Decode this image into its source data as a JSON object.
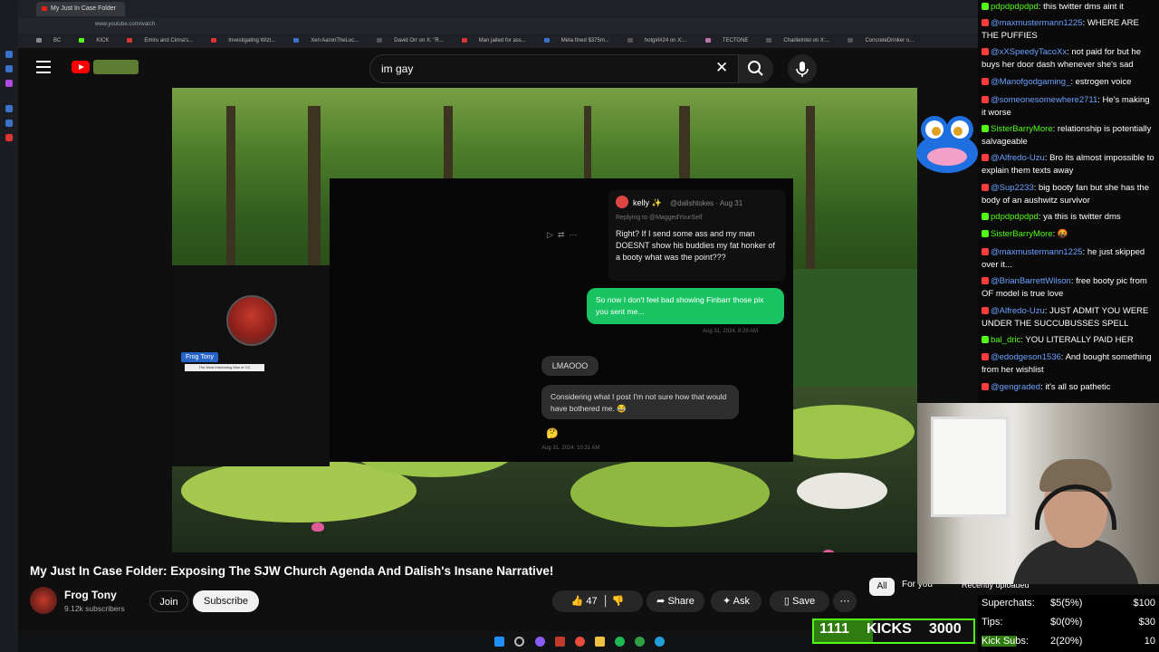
{
  "browser": {
    "active_tab": "My Just In Case Folder",
    "url": "www.youtube.com/watch",
    "bookmarks": [
      "BC",
      "KICK",
      "Emiru and Cinna's...",
      "Investigating Wizt...",
      "Xen AaronTheLoc...",
      "David Orr on X: \"R...",
      "Man jailed for ass...",
      "Meta fined $375m...",
      "hotgirl#24 on X:...",
      "TECTONE",
      "CharlieIntel on X:...",
      "ConcreteDrinker o..."
    ]
  },
  "search": {
    "query": "im gay"
  },
  "video": {
    "stream_name_tag": "Frog Tony",
    "stream_subtag": "The Most Interesting Man in CG",
    "tweet": {
      "author": "kelly ✨",
      "handle": "@dalishtokes · Aug 31",
      "replying": "Replying to @MaggedYourSelf",
      "body": "Right? If I send some ass and my man DOESNT show his buddies my fat honker of a booty what was the point???"
    },
    "dm_green": "So now I don't feel bad showing Finbarr those pix you sent me...",
    "dm_green_time": "Aug 31, 2024, 8:29 AM",
    "dm_lmao": "LMAOOO",
    "dm_consider": "Considering what I post I'm not sure how that would have bothered me. 😂",
    "dm_emoji": "🤔",
    "dm_time2": "Aug 31, 2024, 10:31 AM"
  },
  "meta": {
    "title": "My Just In Case Folder: Exposing The SJW Church Agenda And Dalish's Insane Narrative!",
    "channel": "Frog Tony",
    "subscribers": "9.12k subscribers",
    "join": "Join",
    "subscribe": "Subscribe",
    "likes": "47",
    "share": "Share",
    "ask": "Ask",
    "save": "Save",
    "filters": [
      "All",
      "For you",
      "Recently uploaded"
    ]
  },
  "chat": [
    {
      "platform": "kick",
      "user": "pdpdpdpdpd",
      "msg": "this twitter dms aint it"
    },
    {
      "platform": "youtube",
      "user": "@maxmustermann1225",
      "msg": "WHERE ARE THE PUFFIES"
    },
    {
      "platform": "youtube",
      "user": "@xXSpeedyTacoXx",
      "msg": "not paid for but he buys her door dash whenever she's sad"
    },
    {
      "platform": "youtube",
      "user": "@Manofgodgaming_",
      "msg": "estrogen voice"
    },
    {
      "platform": "youtube",
      "user": "@someonesomewhere2711",
      "msg": "He's making it worse"
    },
    {
      "platform": "kick",
      "user": "SisterBarryMore",
      "msg": "relationship is potentially salvageable"
    },
    {
      "platform": "youtube",
      "user": "@Alfredo-Uzu",
      "msg": "Bro its almost impossible to explain them texts away"
    },
    {
      "platform": "youtube",
      "user": "@Sup2233",
      "msg": "big booty fan but she has the body of an aushwitz survivor"
    },
    {
      "platform": "kick",
      "user": "pdpdpdpdpd",
      "msg": "ya this is twitter dms"
    },
    {
      "platform": "kick",
      "user": "SisterBarryMore",
      "msg": "🤬"
    },
    {
      "platform": "youtube",
      "user": "@maxmustermann1225",
      "msg": "he just skipped over it..."
    },
    {
      "platform": "youtube",
      "user": "@BrianBarrettWilson",
      "msg": "free booty pic from OF model is true love"
    },
    {
      "platform": "youtube",
      "user": "@Alfredo-Uzu",
      "msg": "JUST ADMIT YOU WERE UNDER THE SUCCUBUSSES SPELL"
    },
    {
      "platform": "kick",
      "user": "bal_dric",
      "msg": "YOU LITERALLY PAID HER"
    },
    {
      "platform": "youtube",
      "user": "@edodgeson1536",
      "msg": "And bought something from her wishlist"
    },
    {
      "platform": "youtube",
      "user": "@gengraded",
      "msg": "it's all so pathetic"
    }
  ],
  "goals": [
    {
      "label": "Superchats:",
      "value": "$5(5%)",
      "target": "$100"
    },
    {
      "label": "Tips:",
      "value": "$0(0%)",
      "target": "$30"
    },
    {
      "label": "Kick Subs:",
      "value": "2(20%)",
      "target": "10"
    }
  ],
  "kicks": {
    "current": "1111",
    "label": "KICKS",
    "target": "3000",
    "progress": 0.37
  }
}
